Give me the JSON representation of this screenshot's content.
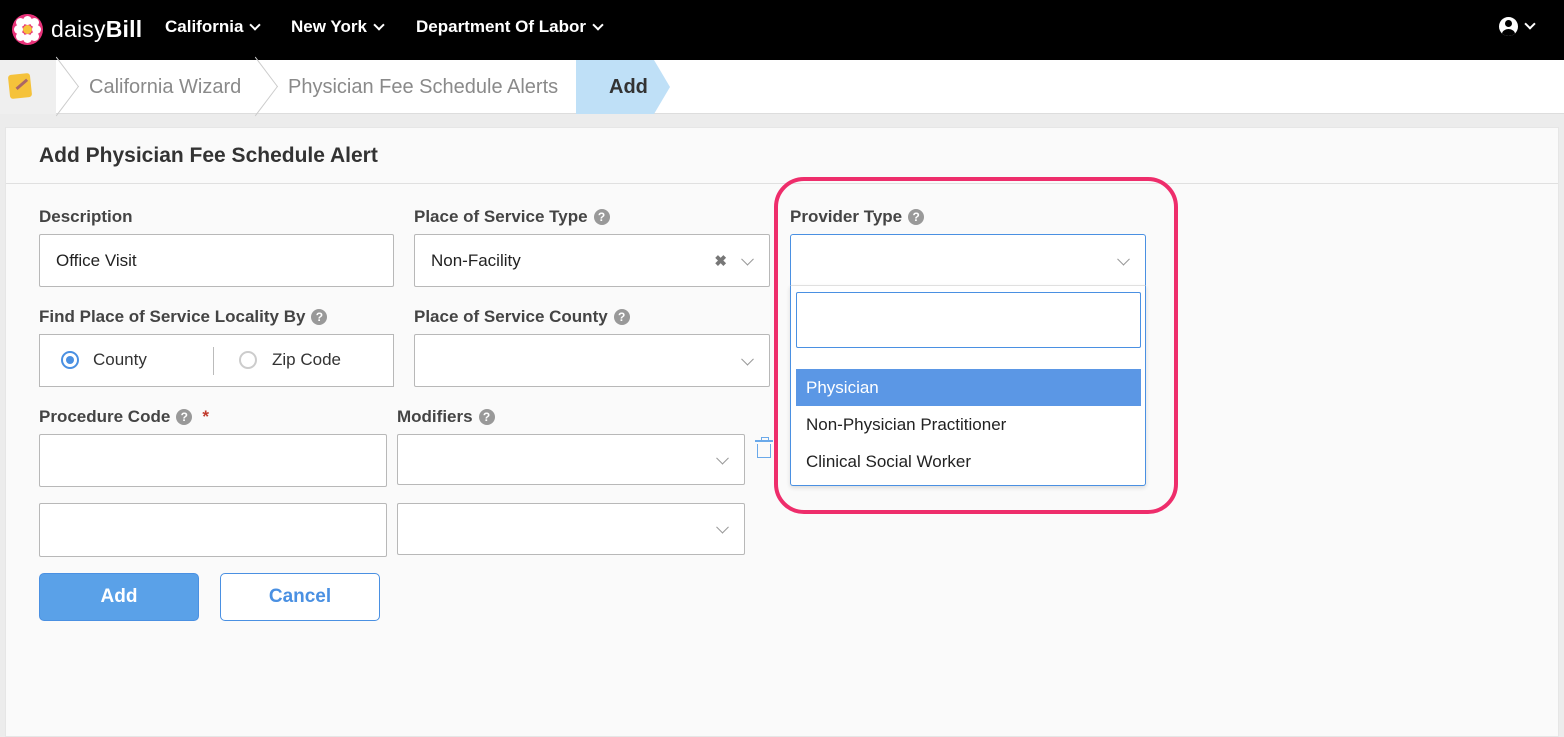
{
  "brand": {
    "name_light": "daisy",
    "name_bold": "Bill"
  },
  "nav": {
    "items": [
      {
        "label": "California"
      },
      {
        "label": "New York"
      },
      {
        "label": "Department Of Labor"
      }
    ]
  },
  "breadcrumb": {
    "items": [
      "California Wizard",
      "Physician Fee Schedule Alerts"
    ],
    "active": "Add"
  },
  "form": {
    "title": "Add Physician Fee Schedule Alert",
    "description": {
      "label": "Description",
      "value": "Office Visit"
    },
    "place_of_service_type": {
      "label": "Place of Service Type",
      "value": "Non-Facility",
      "clear": "✖"
    },
    "provider_type": {
      "label": "Provider Type",
      "value": "",
      "search_value": "",
      "options": [
        "Physician",
        "Non-Physician Practitioner",
        "Clinical Social Worker"
      ],
      "highlighted": "Physician"
    },
    "find_locality_by": {
      "label": "Find Place of Service Locality By",
      "options": [
        "County",
        "Zip Code"
      ],
      "selected": "County"
    },
    "place_of_service_county": {
      "label": "Place of Service County",
      "value": ""
    },
    "procedure_code": {
      "label": "Procedure Code",
      "required_mark": "*",
      "rows": [
        "",
        ""
      ]
    },
    "modifiers": {
      "label": "Modifiers",
      "rows": [
        "",
        ""
      ]
    },
    "help_glyph": "?",
    "add_label": "Add",
    "cancel_label": "Cancel"
  },
  "colors": {
    "accent": "#4a90e2",
    "highlight_ring": "#ee2d6b",
    "option_active": "#5b97e5",
    "brand_pink": "#e8337a"
  },
  "icons": [
    "daisy-logo-icon",
    "chevron-down-icon",
    "user-circle-icon",
    "note-icon",
    "help-icon",
    "clear-icon",
    "trash-icon"
  ]
}
